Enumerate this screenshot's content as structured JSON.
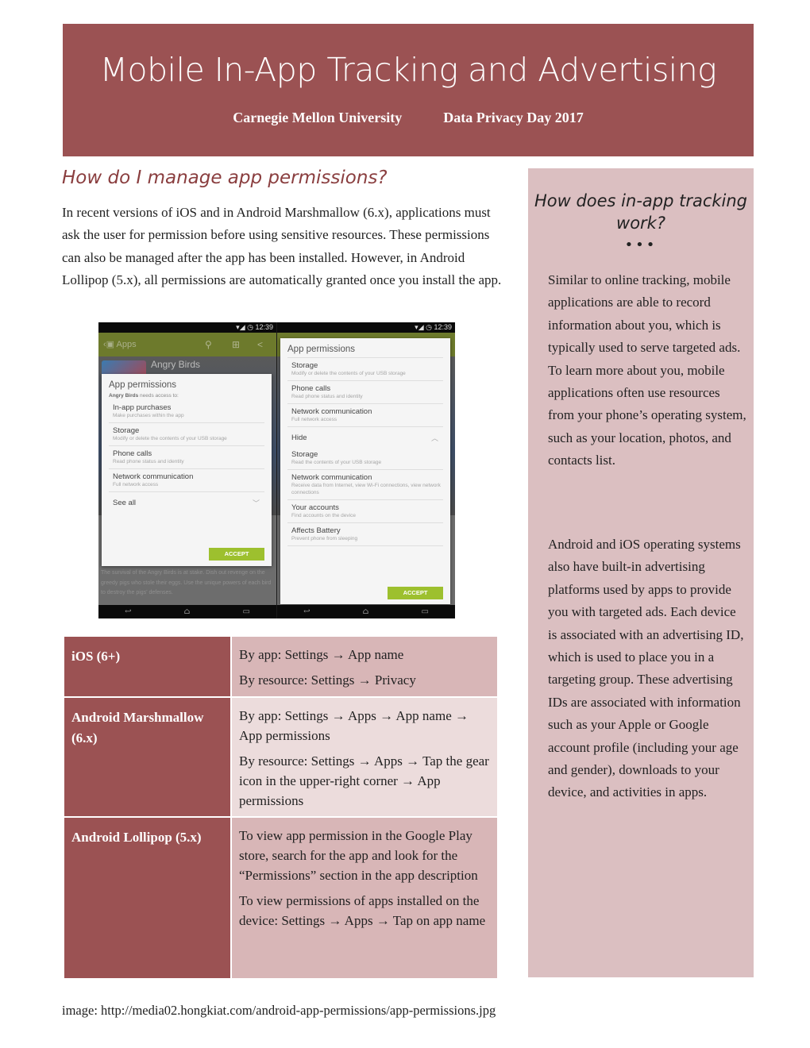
{
  "banner": {
    "title": "Mobile In-App Tracking and Advertising",
    "org": "Carnegie Mellon University",
    "event": "Data Privacy Day 2017",
    "color": "#9b5253"
  },
  "main": {
    "heading": "How do I manage app permissions?",
    "intro": "In recent versions of iOS and in Android Marshmallow (6.x), applications must ask the user for permission before using sensitive resources. These permissions can also be managed after the app has been installed. However, in Android Lollipop (5.x), all permissions are automatically granted once you install the app."
  },
  "screenshot": {
    "time": "12:39",
    "left_phone": {
      "appbar_title": "Apps",
      "app_name": "Angry Birds",
      "dialog_title": "App permissions",
      "needs_app": "Angry Birds",
      "needs_text": "needs access to:",
      "permissions": [
        {
          "name": "In-app purchases",
          "desc": "Make purchases within the app"
        },
        {
          "name": "Storage",
          "desc": "Modify or delete the contents of your USB storage"
        },
        {
          "name": "Phone calls",
          "desc": "Read phone status and identity"
        },
        {
          "name": "Network communication",
          "desc": "Full network access"
        }
      ],
      "see_all": "See all",
      "accept": "ACCEPT",
      "description": "The survival of the Angry Birds is at stake. Dish out revenge on the greedy pigs who stole their eggs. Use the unique powers of each bird to destroy the pigs' defenses."
    },
    "right_phone": {
      "dialog_title": "App permissions",
      "permissions": [
        {
          "name": "Storage",
          "desc": "Modify or delete the contents of your USB storage"
        },
        {
          "name": "Phone calls",
          "desc": "Read phone status and identity"
        },
        {
          "name": "Network communication",
          "desc": "Full network access"
        }
      ],
      "hide": "Hide",
      "hidden_permissions": [
        {
          "name": "Storage",
          "desc": "Read the contents of your USB storage"
        },
        {
          "name": "Network communication",
          "desc": "Receive data from Internet, view Wi-Fi connections, view network connections"
        },
        {
          "name": "Your accounts",
          "desc": "Find accounts on the device"
        },
        {
          "name": "Affects Battery",
          "desc": "Prevent phone from sleeping"
        }
      ],
      "accept": "ACCEPT"
    }
  },
  "table": {
    "rows": [
      {
        "os": "iOS (6+)",
        "steps": [
          "By app: Settings → App name",
          "By resource: Settings → Privacy"
        ]
      },
      {
        "os": "Android Marshmallow (6.x)",
        "steps": [
          "By app: Settings → Apps → App name → App permissions",
          "By resource: Settings → Apps → Tap the gear icon in the upper-right corner → App permissions"
        ]
      },
      {
        "os": "Android Lollipop (5.x)",
        "steps": [
          "To view app permission in the Google Play store, search for the app and look for the “Permissions” section in the app description",
          "To view permissions of apps installed on the device: Settings → Apps → Tap on app name"
        ]
      }
    ]
  },
  "sidebar": {
    "title": "How does in-app tracking work?",
    "dots": "•••",
    "paragraphs": [
      "Similar to online tracking, mobile applications are able to record information about you, which is typically used to serve targeted ads.  To learn more about you, mobile applications often use resources from your phone’s operating system, such as your location, photos, and contacts list.",
      "Android and iOS operating systems also have built-in advertising platforms used by apps to provide you with targeted ads. Each device is associated with an advertising ID, which is used to place you in a targeting group. These advertising IDs are associated with information such as your Apple or Google account profile (including your age and gender), downloads to your device, and activities in apps."
    ],
    "color": "#dbbfc1"
  },
  "caption": "image: http://media02.hongkiat.com/android-app-permissions/app-permissions.jpg"
}
